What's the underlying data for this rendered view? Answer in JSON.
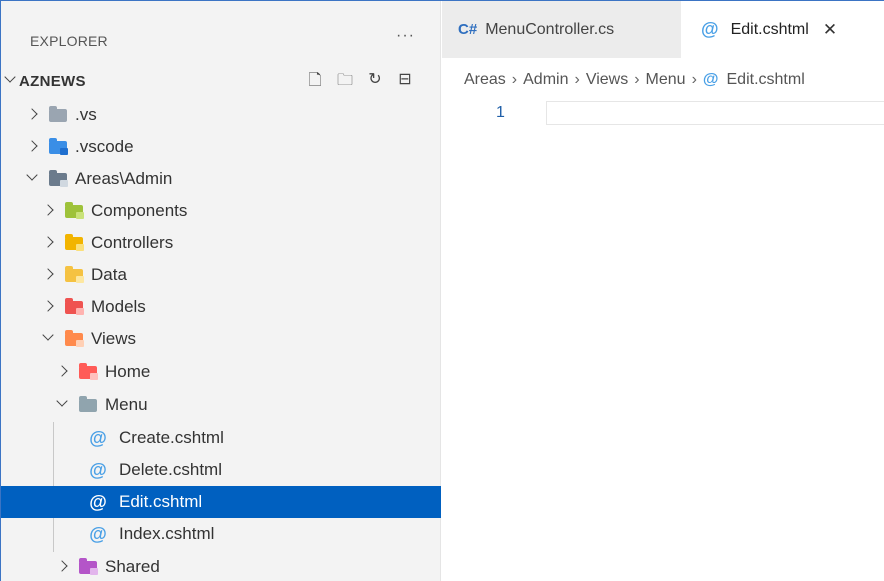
{
  "explorer": {
    "title": "EXPLORER",
    "more": "···",
    "root": {
      "label": "AZNEWS",
      "actions": [
        {
          "name": "new-file-icon",
          "glyph": "🗋"
        },
        {
          "name": "new-folder-icon",
          "glyph": "🗀"
        },
        {
          "name": "refresh-icon",
          "glyph": "↻"
        },
        {
          "name": "collapse-all-icon",
          "glyph": "⊟"
        }
      ]
    },
    "items": [
      {
        "label": ".vs"
      },
      {
        "label": ".vscode"
      },
      {
        "label": "Areas\\Admin"
      },
      {
        "label": "Components"
      },
      {
        "label": "Controllers"
      },
      {
        "label": "Data"
      },
      {
        "label": "Models"
      },
      {
        "label": "Views"
      },
      {
        "label": "Home"
      },
      {
        "label": "Menu"
      },
      {
        "label": "Create.cshtml",
        "icon": "@"
      },
      {
        "label": "Delete.cshtml",
        "icon": "@"
      },
      {
        "label": "Edit.cshtml",
        "icon": "@"
      },
      {
        "label": "Index.cshtml",
        "icon": "@"
      },
      {
        "label": "Shared"
      }
    ]
  },
  "colors": {
    "accent": "#0060c0",
    "vs_folder": "#9aa5b1",
    "vscode_folder": "#3a8ee6",
    "areas_folder": "#6b7b8c",
    "components_folder": "#9ec23a",
    "controllers_folder": "#f2b400",
    "data_folder": "#f5c242",
    "models_folder": "#ef5350",
    "views_folder": "#ff8a4c",
    "home_folder": "#ff5b57",
    "menu_folder": "#90a4ae",
    "shared_folder": "#b455c8"
  },
  "editor": {
    "tabs": [
      {
        "icon": "C#",
        "label": "MenuController.cs"
      },
      {
        "icon": "@",
        "label": "Edit.cshtml",
        "close": "✕"
      }
    ],
    "breadcrumb": [
      "Areas",
      "Admin",
      "Views",
      "Menu",
      "Edit.cshtml"
    ],
    "breadcrumb_sep": "›",
    "line_number": "1"
  }
}
